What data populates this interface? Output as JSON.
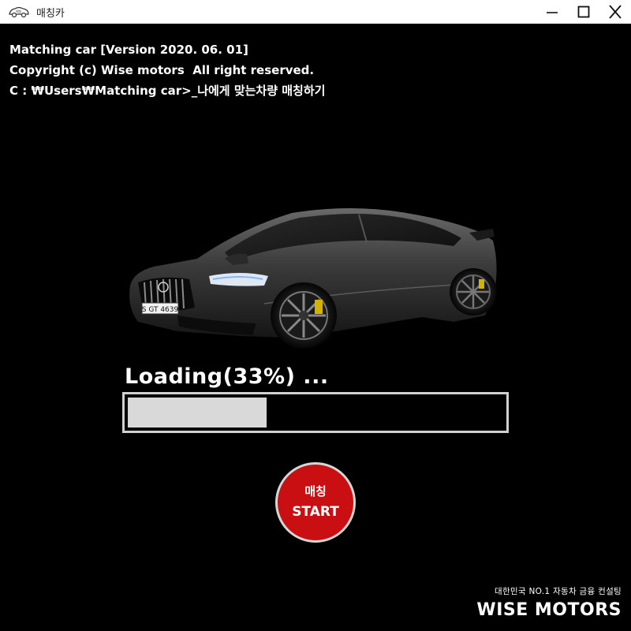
{
  "window": {
    "title": "매칭카",
    "icon": "car-logo-icon",
    "controls": {
      "minimize": "minimize-icon",
      "maximize": "maximize-icon",
      "close": "close-icon"
    }
  },
  "console": {
    "lines": [
      "Matching car [Version 2020. 06. 01]",
      "Copyright (c) Wise motors  All right reserved.",
      "C : ₩Users₩Matching car>_나에게 맞는차량 매칭하기"
    ]
  },
  "car": {
    "plate": "S GT 4639"
  },
  "loading": {
    "label": "Loading(33%) ...",
    "progress": 0.33
  },
  "start_button": {
    "line1": "매칭",
    "line2": "START",
    "color": "#c90f12"
  },
  "brand": {
    "tagline": "대한민국 NO.1 자동차 금융 컨설팅",
    "name": "WISE MOTORS"
  }
}
